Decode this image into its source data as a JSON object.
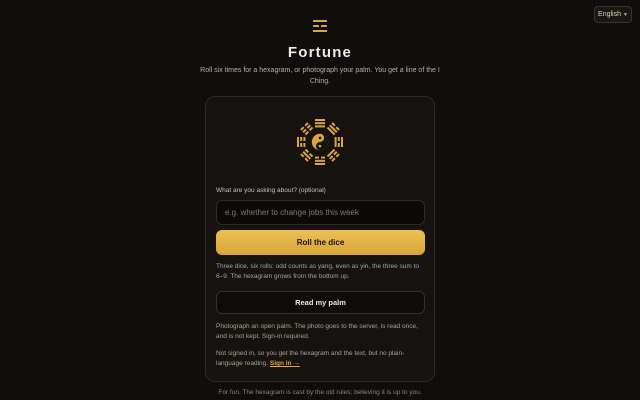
{
  "header": {
    "language_label": "English",
    "language_icon": "chevron-down-icon",
    "logo_icon": "trigram-icon",
    "title": "Fortune",
    "subtitle": "Roll six times for a hexagram, or photograph your palm. You get a line of the I Ching."
  },
  "card": {
    "emblem_icon": "bagua-yin-yang-icon",
    "question_label": "What are you asking about? (optional)",
    "question_value": "",
    "question_placeholder": "e.g. whether to change jobs this week",
    "roll_label": "Roll the dice",
    "roll_note": "Three dice, six rolls: odd counts as yang, even as yin, the three sum to 6–9. The hexagram grows from the bottom up.",
    "palm_label": "Read my palm",
    "palm_note": "Photograph an open palm. The photo goes to the server, is read once, and is not kept. Sign-in required.",
    "signin_note": "Not signed in, so you get the hexagram and the text, but no plain-language reading.",
    "signin_link": "Sign in →"
  },
  "footer": {
    "text": "For fun. The hexagram is cast by the old rules; believing it is up to you."
  },
  "colors": {
    "accent": "#e1a93c",
    "button_gradient_top": "#ecc054",
    "button_gradient_bottom": "#d9a53a",
    "background": "#0f0d0b",
    "card": "#15120f"
  }
}
